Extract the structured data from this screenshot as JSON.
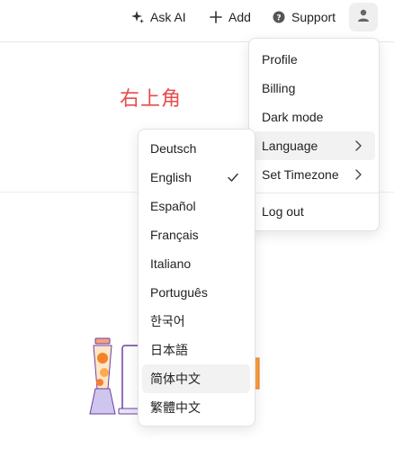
{
  "toolbar": {
    "ask_ai": "Ask AI",
    "add": "Add",
    "support": "Support"
  },
  "content": {
    "corner_label": "右上角"
  },
  "profile_menu": {
    "items": [
      {
        "label": "Profile"
      },
      {
        "label": "Billing"
      },
      {
        "label": "Dark mode"
      },
      {
        "label": "Language"
      },
      {
        "label": "Set Timezone"
      },
      {
        "label": "Log out"
      }
    ]
  },
  "language_menu": {
    "selected": "English",
    "hovered": "简体中文",
    "items": [
      {
        "label": "Deutsch"
      },
      {
        "label": "English"
      },
      {
        "label": "Español"
      },
      {
        "label": "Français"
      },
      {
        "label": "Italiano"
      },
      {
        "label": "Português"
      },
      {
        "label": "한국어"
      },
      {
        "label": "日本語"
      },
      {
        "label": "简体中文"
      },
      {
        "label": "繁體中文"
      }
    ]
  },
  "colors": {
    "accent_label": "#e94b4b",
    "hover_bg": "#f2f2f2"
  }
}
